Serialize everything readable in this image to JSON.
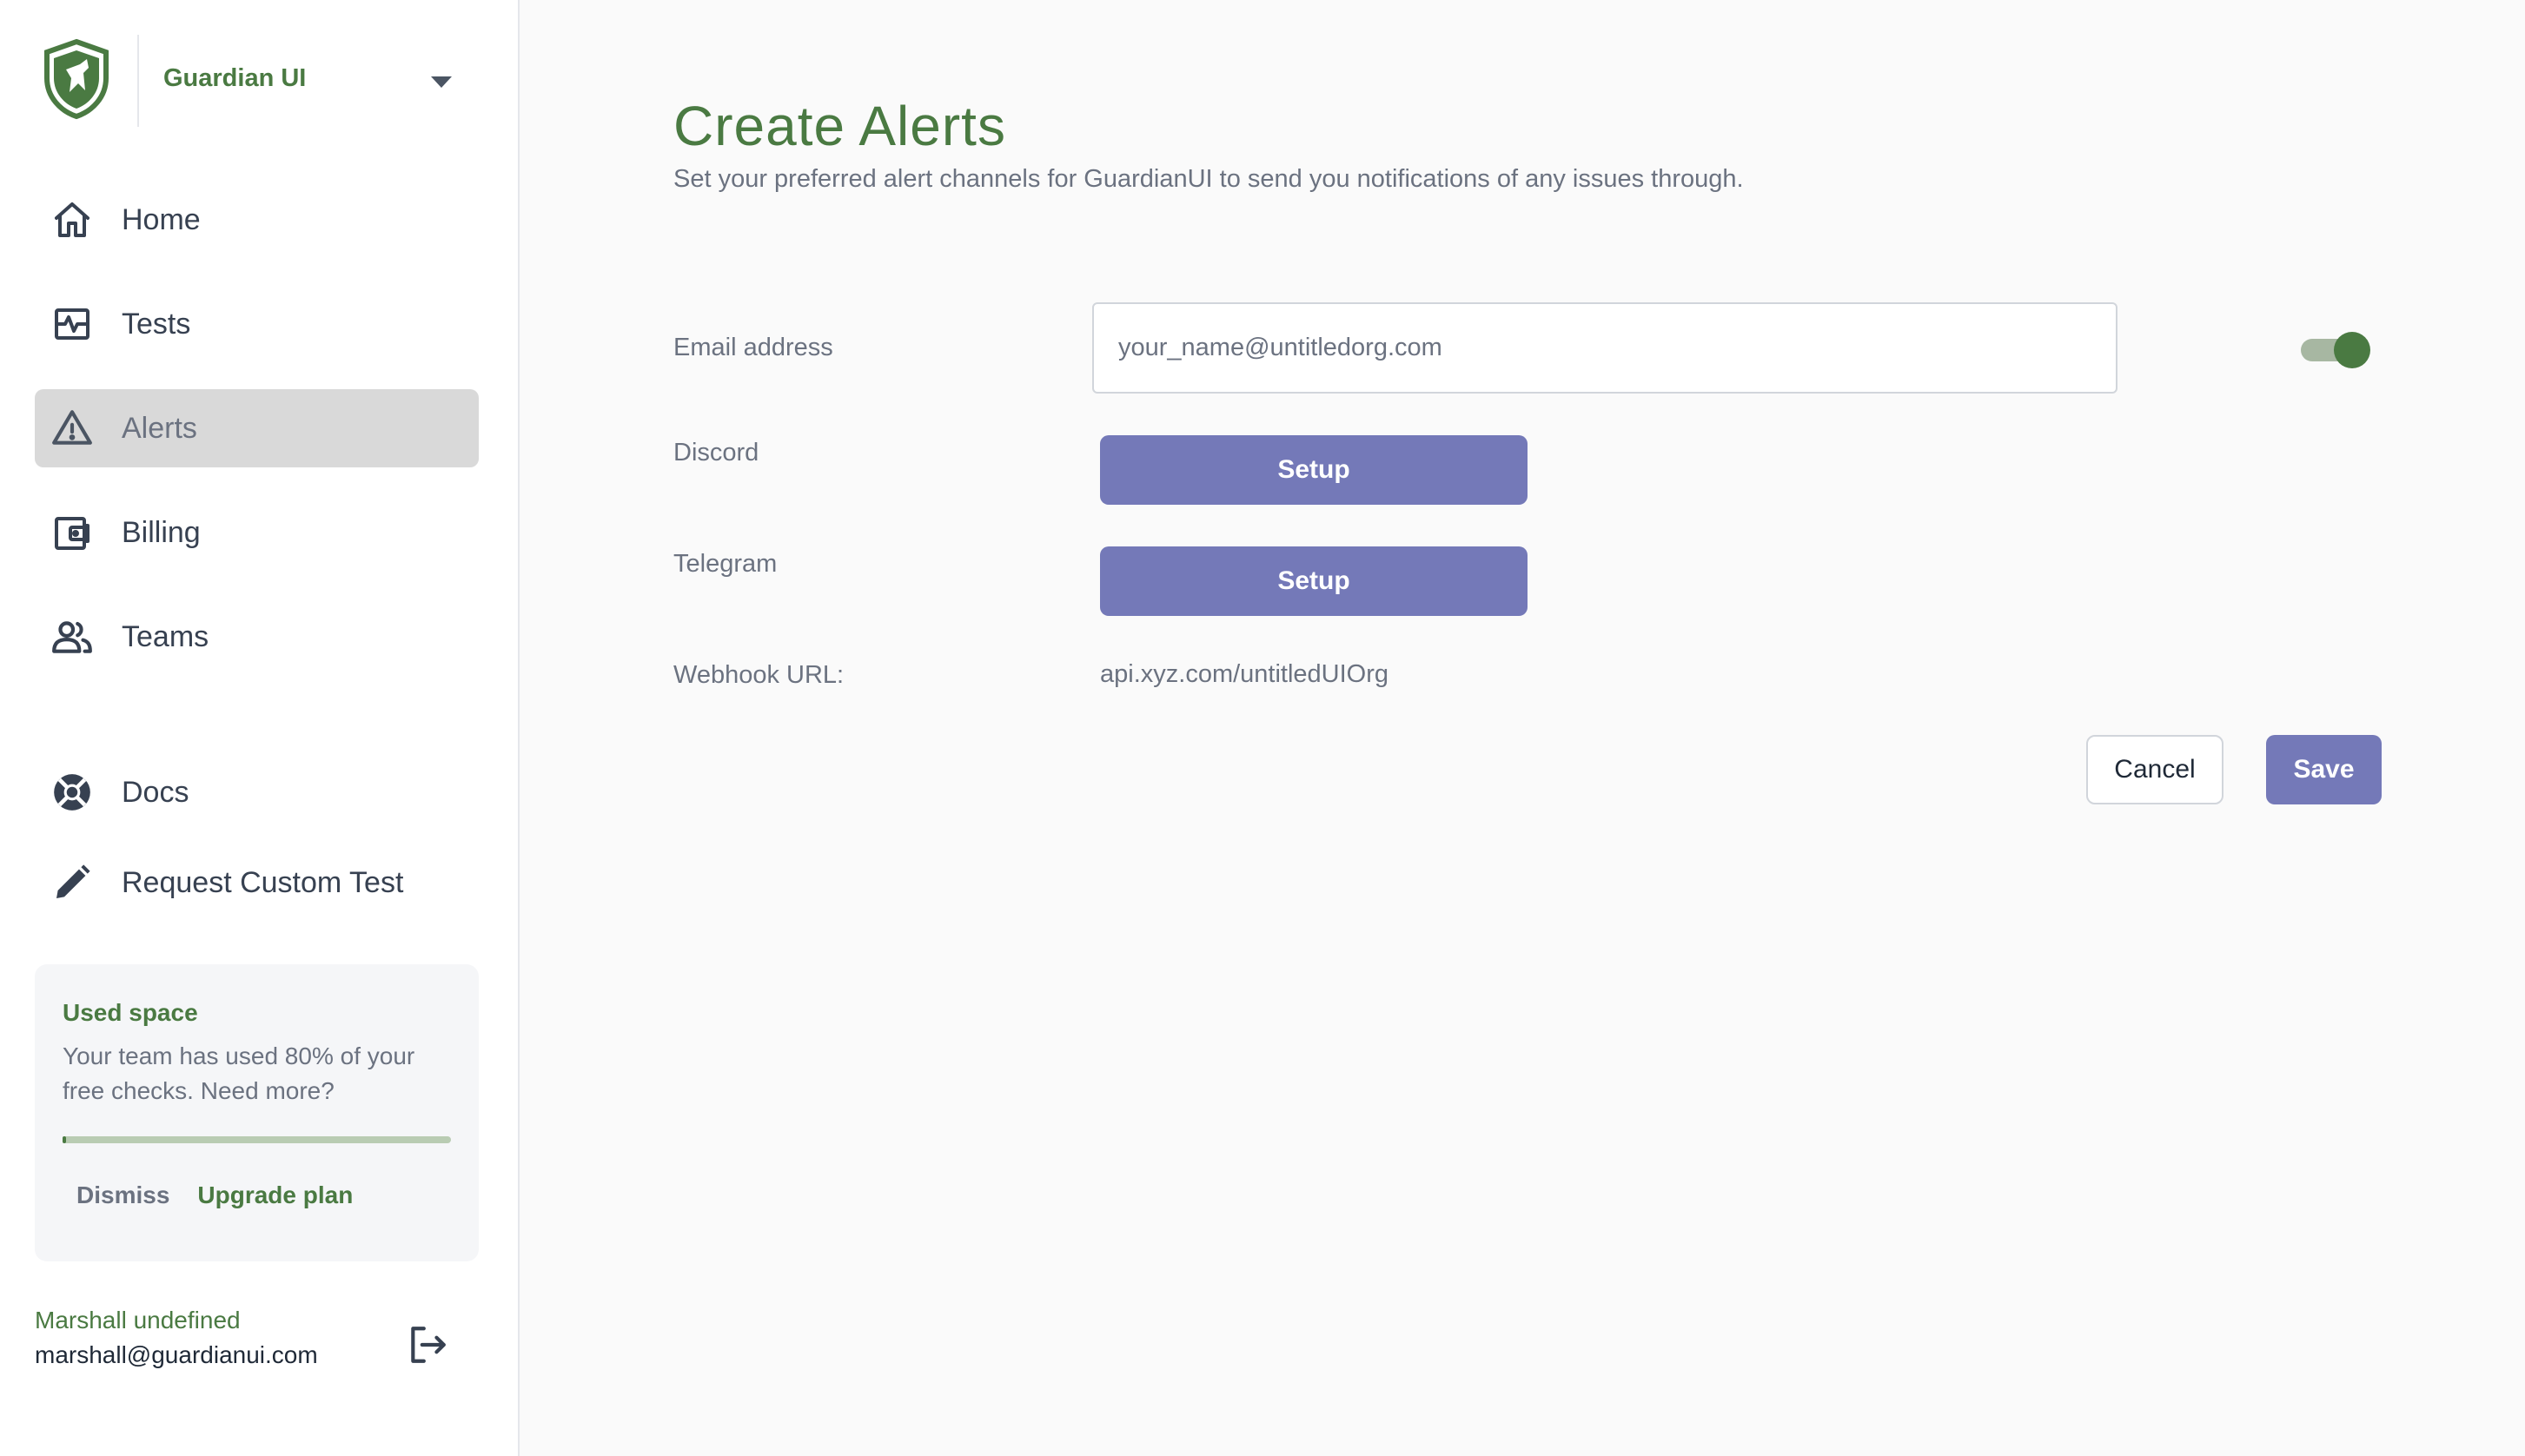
{
  "brand": {
    "name": "Guardian UI",
    "logo_icon": "shield-dog-icon"
  },
  "sidebar": {
    "items": [
      {
        "label": "Home",
        "icon": "home-icon",
        "active": false
      },
      {
        "label": "Tests",
        "icon": "tests-icon",
        "active": false
      },
      {
        "label": "Alerts",
        "icon": "alert-triangle-icon",
        "active": true
      },
      {
        "label": "Billing",
        "icon": "wallet-icon",
        "active": false
      },
      {
        "label": "Teams",
        "icon": "users-icon",
        "active": false
      }
    ],
    "secondary_items": [
      {
        "label": "Docs",
        "icon": "lifebuoy-icon"
      },
      {
        "label": "Request Custom Test",
        "icon": "pencil-icon"
      }
    ]
  },
  "usage": {
    "title": "Used space",
    "text": "Your team has used 80% of your free checks. Need more?",
    "percent": 0.8,
    "dismiss_label": "Dismiss",
    "upgrade_label": "Upgrade plan"
  },
  "user": {
    "name": "Marshall undefined",
    "email": "marshall@guardianui.com",
    "logout_icon": "logout-icon"
  },
  "page": {
    "title": "Create Alerts",
    "subtitle": "Set your preferred alert channels for GuardianUI to send you notifications of any issues through."
  },
  "form": {
    "email_label": "Email address",
    "email_placeholder": "your_name@untitledorg.com",
    "email_value": "",
    "email_toggle_on": true,
    "discord_label": "Discord",
    "discord_button": "Setup",
    "telegram_label": "Telegram",
    "telegram_button": "Setup",
    "webhook_label": "Webhook URL:",
    "webhook_value": "api.xyz.com/untitledUIOrg"
  },
  "actions": {
    "cancel_label": "Cancel",
    "save_label": "Save"
  },
  "colors": {
    "brand_green": "#4a7a42",
    "accent_purple": "#7479b8",
    "active_nav_bg": "#d9d9d9"
  }
}
